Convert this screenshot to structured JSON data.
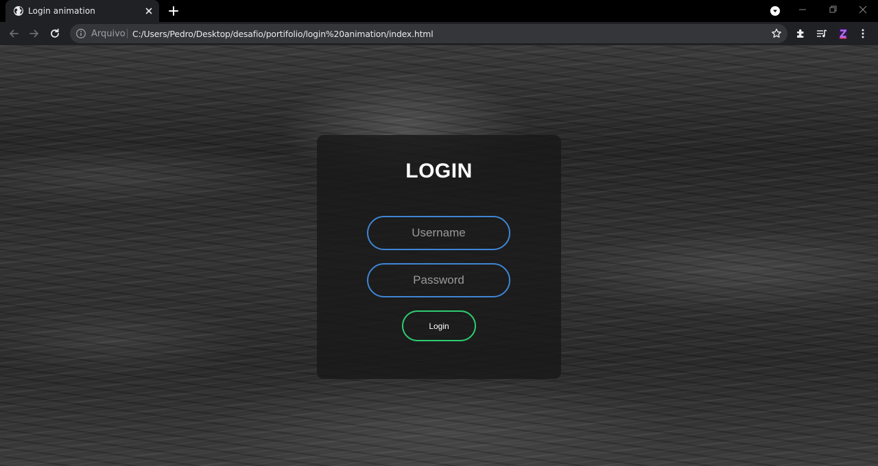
{
  "tab": {
    "title": "Login animation",
    "favicon": "globe-icon",
    "close_icon": "close-icon"
  },
  "new_tab_icon": "plus-icon",
  "window_controls": [
    "minimize-icon",
    "maximize-icon",
    "close-icon"
  ],
  "toolbar": {
    "back_icon": "arrow-left-icon",
    "forward_icon": "arrow-right-icon",
    "reload_icon": "reload-icon",
    "extensions_icon": "puzzle-icon",
    "media_icon": "playlist-icon",
    "profile_icon": "profile-z-icon",
    "menu_icon": "kebab-menu-icon"
  },
  "omnibox": {
    "scheme_label": "Arquivo",
    "url": "C:/Users/Pedro/Desktop/desafio/portifolio/login%20animation/index.html",
    "bookmark_icon": "star-icon"
  },
  "login": {
    "title": "LOGIN",
    "username_placeholder": "Username",
    "password_placeholder": "Password",
    "button_label": "Login"
  },
  "colors": {
    "input_border": "#3f86d6",
    "button_border": "#2ecc71",
    "card_background": "#181818",
    "chrome_background": "#202124"
  }
}
